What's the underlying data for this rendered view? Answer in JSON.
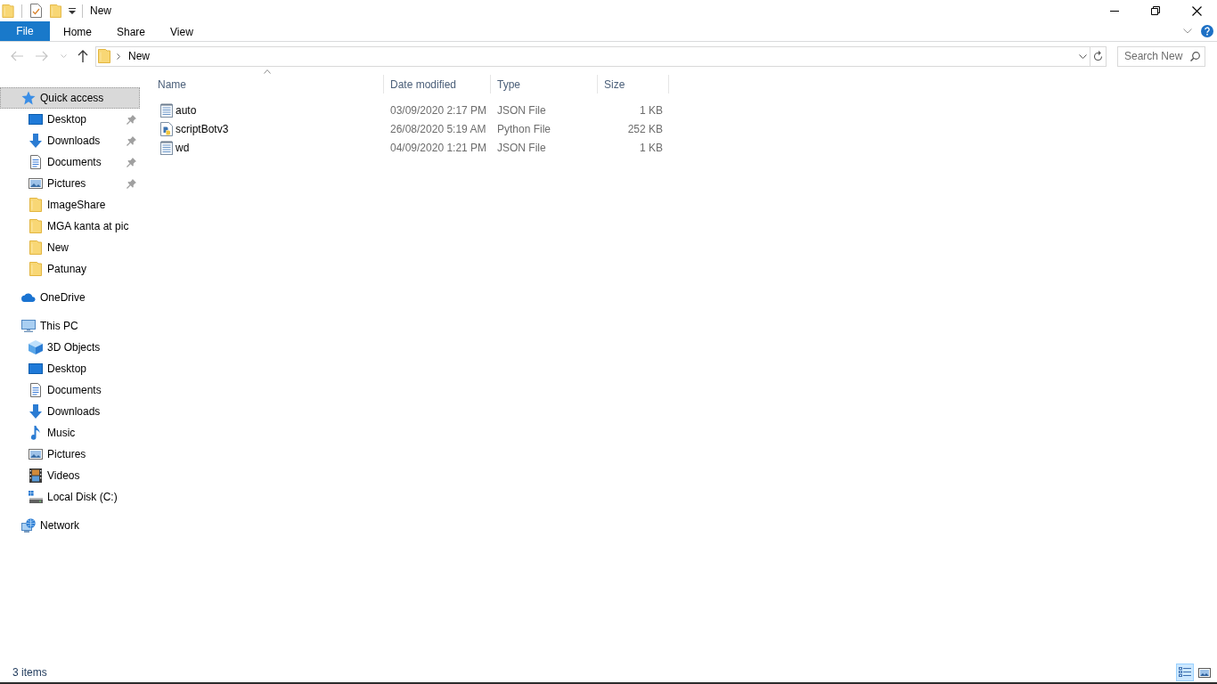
{
  "title_bar": {
    "title": "New"
  },
  "ribbon": {
    "tabs": [
      {
        "label": "File",
        "kind": "backstage",
        "selected": false
      },
      {
        "label": "Home",
        "kind": "tab",
        "selected": false
      },
      {
        "label": "Share",
        "kind": "tab",
        "selected": false
      },
      {
        "label": "View",
        "kind": "tab",
        "selected": false
      }
    ]
  },
  "navigation": {
    "buttons": [
      {
        "kind": "back",
        "disabled": true
      },
      {
        "kind": "forward",
        "disabled": true
      },
      {
        "kind": "recent",
        "disabled": true
      },
      {
        "kind": "up",
        "disabled": false
      }
    ],
    "address": {
      "crumbs": [
        "New"
      ]
    },
    "search": {
      "placeholder": "Search New"
    }
  },
  "sidebar": {
    "items": [
      {
        "label": "Quick access",
        "kind": "quickaccess",
        "selected": true,
        "children": [
          {
            "label": "Desktop",
            "kind": "desktop",
            "selected": false,
            "pinned": true
          },
          {
            "label": "Downloads",
            "kind": "downloads",
            "selected": false,
            "pinned": true
          },
          {
            "label": "Documents",
            "kind": "documents",
            "selected": false,
            "pinned": true
          },
          {
            "label": "Pictures",
            "kind": "pictures",
            "selected": false,
            "pinned": true
          },
          {
            "label": "ImageShare",
            "kind": "folder",
            "selected": false,
            "pinned": false
          },
          {
            "label": "MGA kanta at pic",
            "kind": "folder",
            "selected": false,
            "pinned": false
          },
          {
            "label": "New",
            "kind": "folder",
            "selected": false,
            "pinned": false
          },
          {
            "label": "Patunay",
            "kind": "folder",
            "selected": false,
            "pinned": false
          }
        ]
      },
      {
        "label": "OneDrive",
        "kind": "onedrive",
        "selected": false
      },
      {
        "label": "This PC",
        "kind": "computer",
        "selected": false,
        "children": [
          {
            "label": "3D Objects",
            "kind": "objects",
            "selected": false
          },
          {
            "label": "Desktop",
            "kind": "desktop",
            "selected": false
          },
          {
            "label": "Documents",
            "kind": "documents",
            "selected": false
          },
          {
            "label": "Downloads",
            "kind": "downloads",
            "selected": false
          },
          {
            "label": "Music",
            "kind": "music",
            "selected": false
          },
          {
            "label": "Pictures",
            "kind": "pictures",
            "selected": false
          },
          {
            "label": "Videos",
            "kind": "videos",
            "selected": false
          },
          {
            "label": "Local Disk (C:)",
            "kind": "drive",
            "selected": false
          }
        ]
      },
      {
        "label": "Network",
        "kind": "network",
        "selected": false
      }
    ]
  },
  "table": {
    "columns": [
      {
        "label": "Name",
        "sorted": true
      },
      {
        "label": "Date modified",
        "sorted": false
      },
      {
        "label": "Type",
        "sorted": false
      },
      {
        "label": "Size",
        "sorted": false
      }
    ],
    "rows": [
      {
        "kind": "text",
        "name": "auto",
        "date_modified": "03/09/2020 2:17 PM",
        "type": "JSON File",
        "size": "1 KB"
      },
      {
        "kind": "python",
        "name": "scriptBotv3",
        "date_modified": "26/08/2020 5:19 AM",
        "type": "Python File",
        "size": "252 KB"
      },
      {
        "kind": "text",
        "name": "wd",
        "date_modified": "04/09/2020 1:21 PM",
        "type": "JSON File",
        "size": "1 KB"
      }
    ]
  },
  "status_bar": {
    "item_count": "3 items",
    "views": [
      {
        "kind": "details",
        "selected": true
      },
      {
        "kind": "largeicons",
        "selected": false
      }
    ]
  }
}
